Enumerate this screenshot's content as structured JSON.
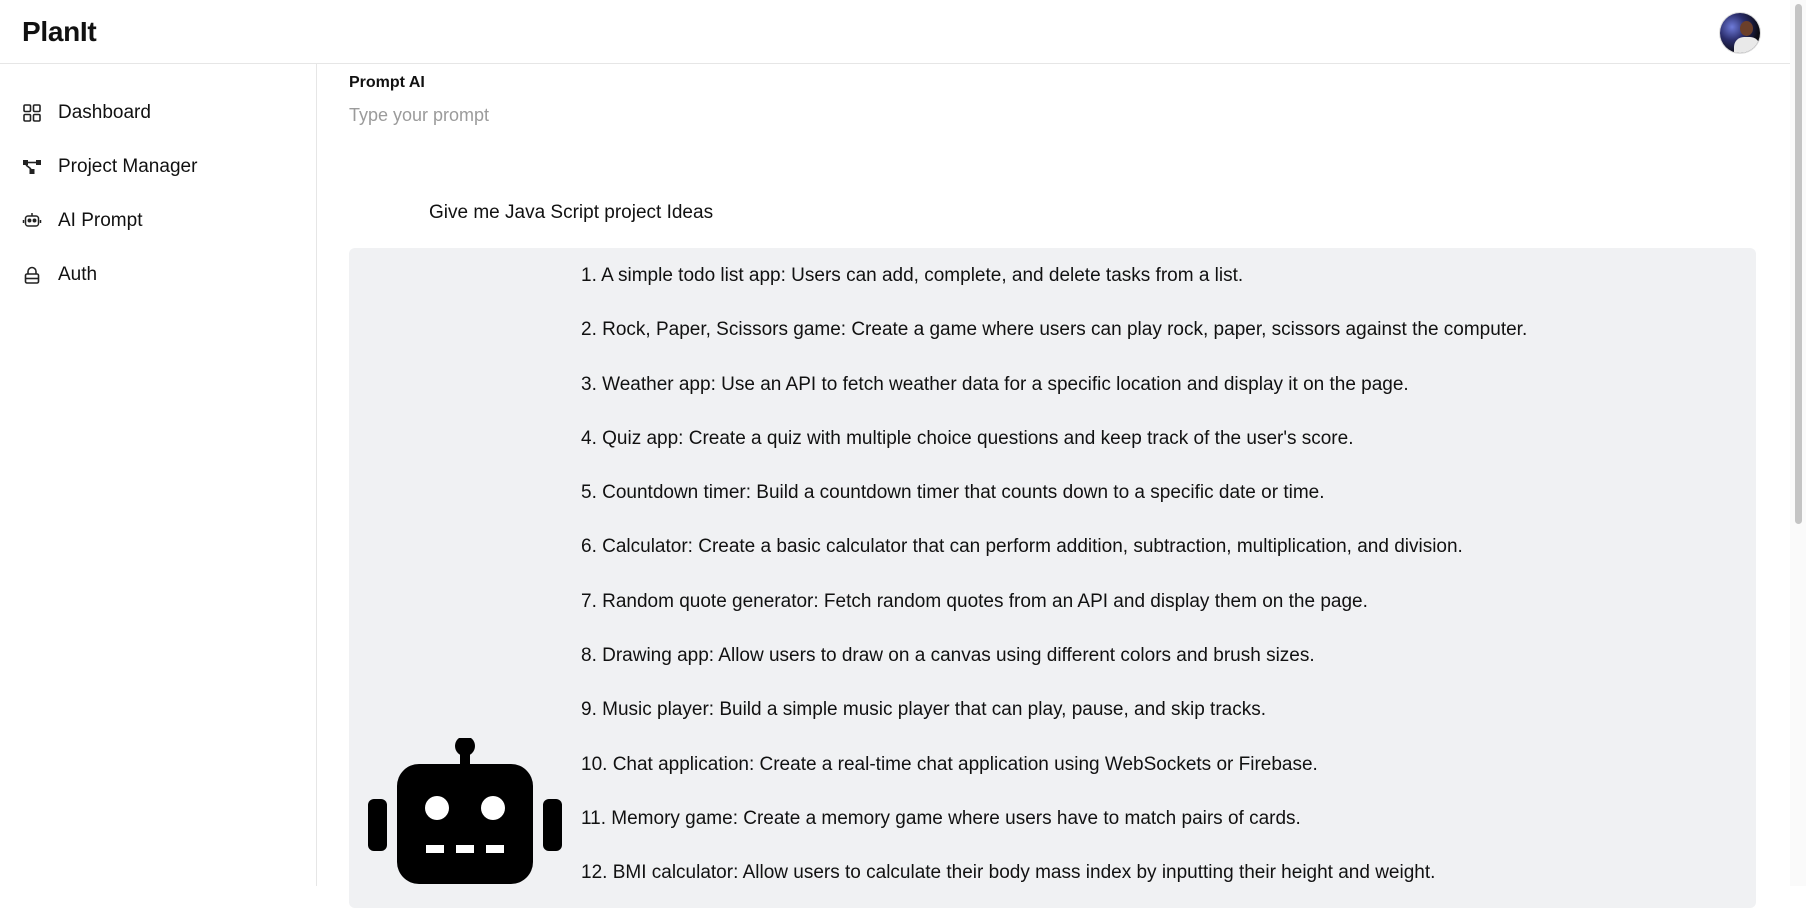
{
  "app": {
    "title": "PlanIt"
  },
  "sidebar": {
    "items": [
      {
        "label": "Dashboard",
        "icon": "grid-icon"
      },
      {
        "label": "Project Manager",
        "icon": "hierarchy-icon"
      },
      {
        "label": "AI Prompt",
        "icon": "robot-icon"
      },
      {
        "label": "Auth",
        "icon": "lock-icon"
      }
    ]
  },
  "prompt": {
    "label": "Prompt AI",
    "placeholder": "Type your prompt",
    "value": ""
  },
  "conversation": {
    "user_message": "Give me Java Script project Ideas",
    "bot_icon": "robot-icon",
    "response_items": [
      "1. A simple todo list app: Users can add, complete, and delete tasks from a list.",
      "2. Rock, Paper, Scissors game: Create a game where users can play rock, paper, scissors against the computer.",
      "3. Weather app: Use an API to fetch weather data for a specific location and display it on the page.",
      "4. Quiz app: Create a quiz with multiple choice questions and keep track of the user's score.",
      "5. Countdown timer: Build a countdown timer that counts down to a specific date or time.",
      "6. Calculator: Create a basic calculator that can perform addition, subtraction, multiplication, and division.",
      "7. Random quote generator: Fetch random quotes from an API and display them on the page.",
      "8. Drawing app: Allow users to draw on a canvas using different colors and brush sizes.",
      "9. Music player: Build a simple music player that can play, pause, and skip tracks.",
      "10. Chat application: Create a real-time chat application using WebSockets or Firebase.",
      "11. Memory game: Create a memory game where users have to match pairs of cards.",
      "12. BMI calculator: Allow users to calculate their body mass index by inputting their height and weight."
    ]
  },
  "colors": {
    "response_bg": "#f0f1f3",
    "border": "#e6e6e6",
    "text": "#111111",
    "placeholder": "#9b9b9b"
  }
}
